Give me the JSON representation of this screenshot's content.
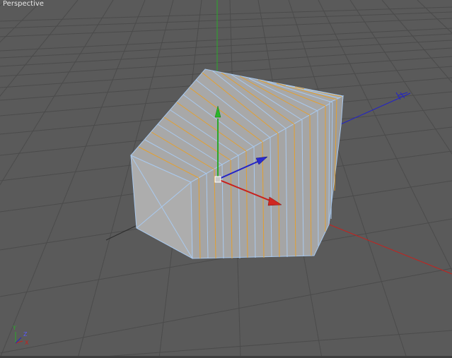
{
  "viewport": {
    "label": "Perspective"
  },
  "axis_gizmo": {
    "y_label": "Y",
    "z_label": "Z",
    "x_label": "X"
  },
  "colors": {
    "background": "#5a5a5a",
    "grid_line": "#4b4b4b",
    "grid_major": "#424242",
    "face_color": "#a9a9a9",
    "wire_blue": "#a9c9ee",
    "wire_orange": "#e3a030",
    "axis_x": "#c8201c",
    "axis_y": "#2aa82a",
    "axis_z": "#2222c8"
  }
}
